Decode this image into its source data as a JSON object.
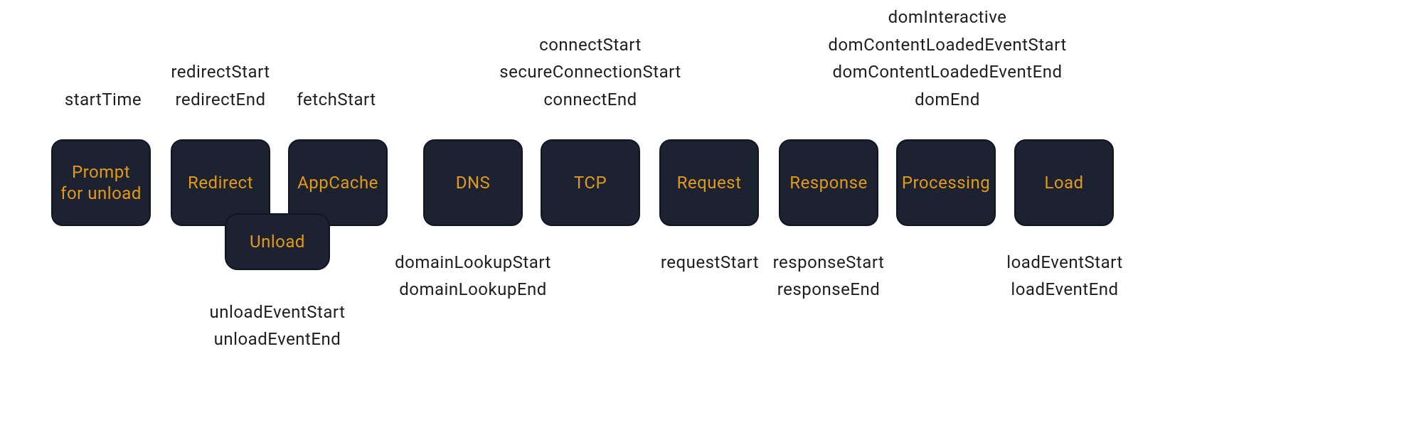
{
  "stages": {
    "prompt": {
      "label": "Prompt\nfor unload"
    },
    "redirect": {
      "label": "Redirect"
    },
    "appcache": {
      "label": "AppCache"
    },
    "dns": {
      "label": "DNS"
    },
    "tcp": {
      "label": "TCP"
    },
    "request": {
      "label": "Request"
    },
    "response": {
      "label": "Response"
    },
    "processing": {
      "label": "Processing"
    },
    "load": {
      "label": "Load"
    },
    "unload": {
      "label": "Unload"
    }
  },
  "annotations": {
    "prompt_top": "startTime",
    "redirect_top": "redirectStart\nredirectEnd",
    "appcache_top": "fetchStart",
    "tcp_top": "connectStart\nsecureConnectionStart\nconnectEnd",
    "processing_top": "domInteractive\ndomContentLoadedEventStart\ndomContentLoadedEventEnd\ndomEnd",
    "dns_bottom": "domainLookupStart\ndomainLookupEnd",
    "request_bottom": "requestStart",
    "response_bottom": "responseStart\nresponseEnd",
    "load_bottom": "loadEventStart\nloadEventEnd",
    "unload_bottom": "unloadEventStart\nunloadEventEnd"
  }
}
